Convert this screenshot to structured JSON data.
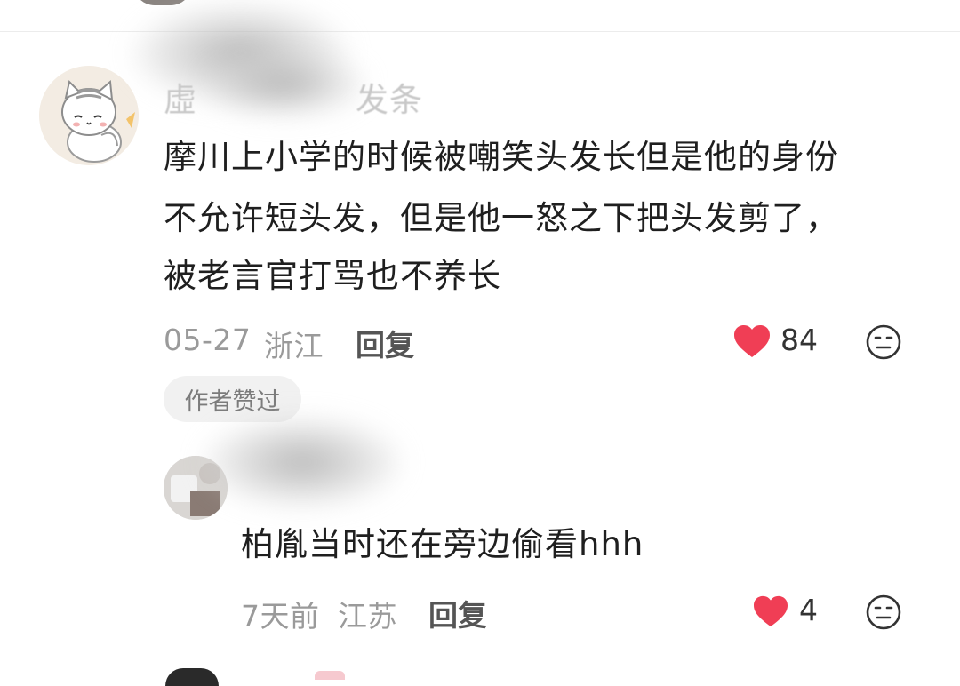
{
  "comment": {
    "username_visible_fragments": [
      "虛",
      "发条"
    ],
    "text_lines": [
      "摩川上小学的时候被嘲笑头发长但是他的身份",
      "不允许短头发，但是他一怒之下把头发剪了，",
      "被老言官打骂也不养长"
    ],
    "date": "05-27",
    "location": "浙江",
    "reply_label": "回复",
    "like_count": "84",
    "author_badge": "作者赞过"
  },
  "reply": {
    "text": "柏胤当时还在旁边偷看hhh",
    "time": "7天前",
    "location": "江苏",
    "reply_label": "回复",
    "like_count": "4"
  },
  "icons": {
    "like": "heart-icon",
    "dislike": "dislike-face-icon"
  },
  "colors": {
    "like_red": "#f03e55",
    "meta_gray": "#9a9a9a",
    "badge_bg": "#f1f1f1"
  }
}
